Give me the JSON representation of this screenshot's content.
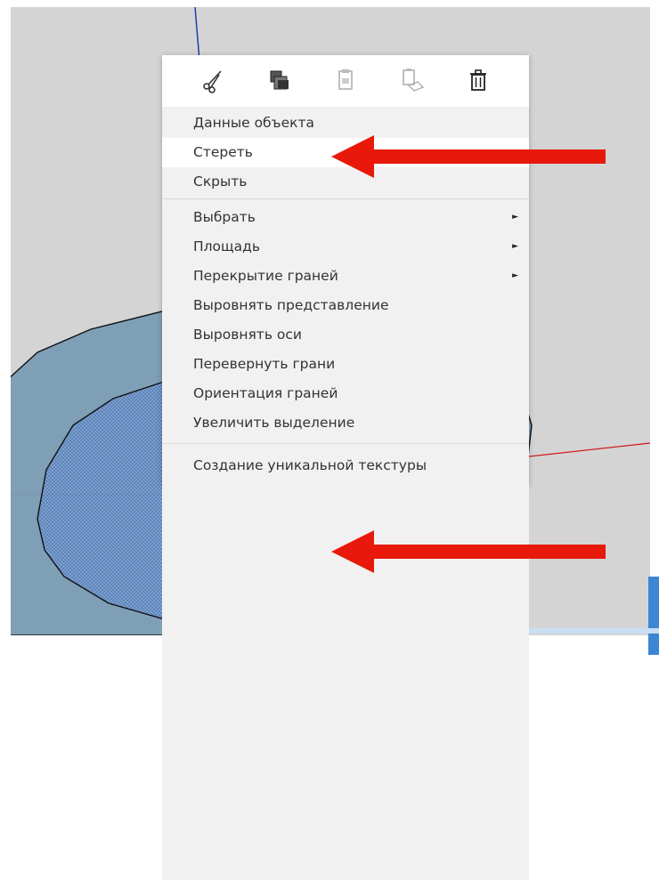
{
  "toolbar": {
    "icons": [
      "cut-icon",
      "copy-icon",
      "paste-icon",
      "paste-in-place-icon",
      "delete-icon"
    ]
  },
  "menu": {
    "group1": [
      {
        "label": "Данные объекта"
      },
      {
        "label": "Стереть"
      },
      {
        "label": "Скрыть"
      }
    ],
    "group2": [
      {
        "label": "Выбрать",
        "submenu": "►"
      },
      {
        "label": "Площадь",
        "submenu": "►"
      },
      {
        "label": "Перекрытие граней",
        "submenu": "►"
      },
      {
        "label": "Выровнять представление"
      },
      {
        "label": "Выровнять оси"
      },
      {
        "label": "Перевернуть грани"
      },
      {
        "label": "Ориентация граней"
      },
      {
        "label": "Увеличить выделение"
      }
    ],
    "group3": [
      {
        "label": "Создание уникальной текстуры"
      }
    ]
  },
  "colors": {
    "annotation_arrow": "#e8190b",
    "face_fill": "#7f9fb7",
    "selected_face": "#6f90c4",
    "canvas": "#d4d4d4",
    "red_axis": "#d11a1a",
    "blue_axis": "#1f3fa8"
  }
}
